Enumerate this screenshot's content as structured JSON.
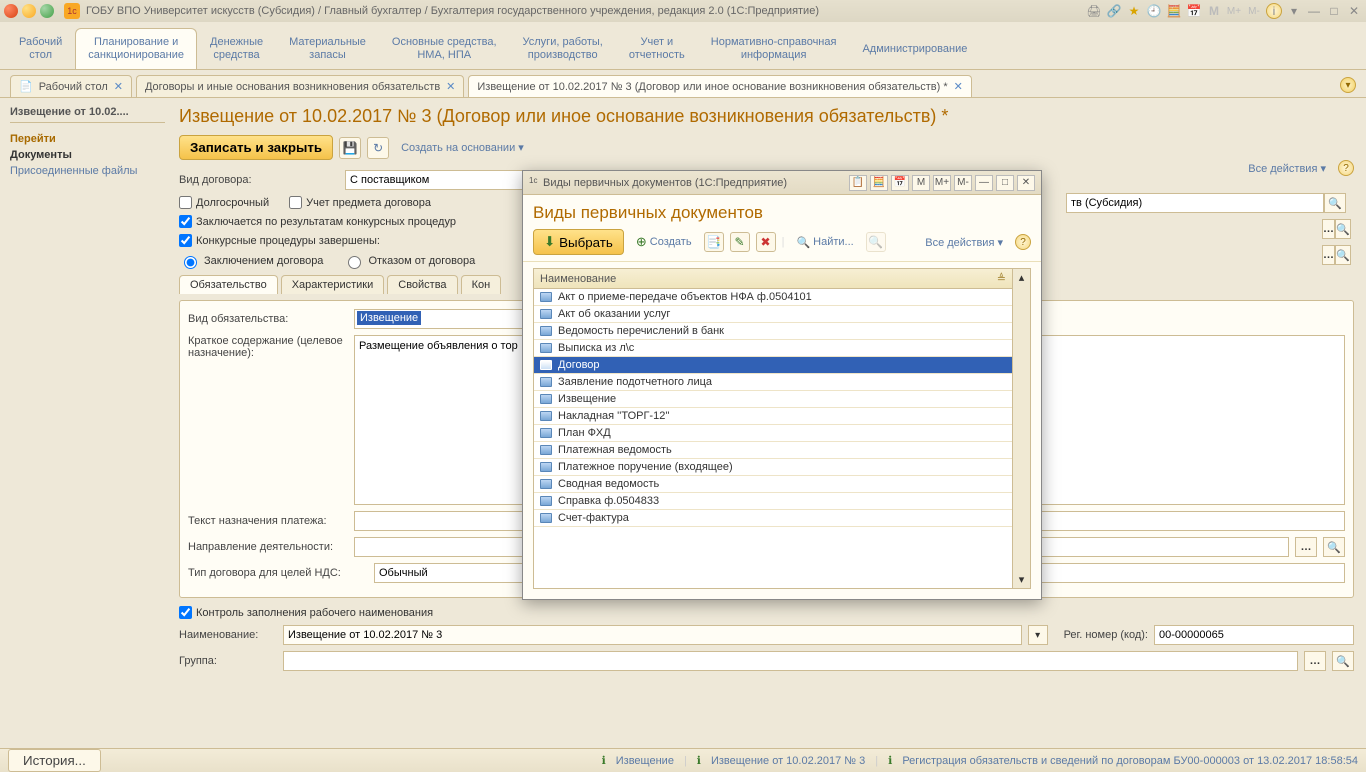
{
  "window": {
    "title": "ГОБУ ВПО Университет искусств (Субсидия) / Главный бухгалтер / Бухгалтерия государственного учреждения, редакция 2.0  (1С:Предприятие)",
    "logo": "1с"
  },
  "main_tabs": [
    {
      "line1": "Рабочий",
      "line2": "стол"
    },
    {
      "line1": "Планирование и",
      "line2": "санкционирование"
    },
    {
      "line1": "Денежные",
      "line2": "средства"
    },
    {
      "line1": "Материальные",
      "line2": "запасы"
    },
    {
      "line1": "Основные средства,",
      "line2": "НМА, НПА"
    },
    {
      "line1": "Услуги, работы,",
      "line2": "производство"
    },
    {
      "line1": "Учет и",
      "line2": "отчетность"
    },
    {
      "line1": "Нормативно-справочная",
      "line2": "информация"
    },
    {
      "line1": "Администрирование",
      "line2": ""
    }
  ],
  "doc_tabs": [
    {
      "label": "Рабочий стол",
      "closable": true,
      "icon": true
    },
    {
      "label": "Договоры и иные основания возникновения обязательств",
      "closable": true
    },
    {
      "label": "Извещение от 10.02.2017 № 3 (Договор или иное основание возникновения обязательств) *",
      "closable": true
    }
  ],
  "sidebar": {
    "header": "Извещение от 10.02....",
    "section1": "Перейти",
    "item1": "Документы",
    "item2": "Присоединенные файлы"
  },
  "page": {
    "title": "Извещение от 10.02.2017 № 3 (Договор или иное основание возникновения обязательств) *",
    "save_close": "Записать и закрыть",
    "create_based": "Создать на основании",
    "all_actions": "Все действия",
    "contract_type_label": "Вид договора:",
    "contract_type_value": "С поставщиком",
    "org_value": "тв (Субсидия)",
    "chk_long": "Долгосрочный",
    "chk_usage": "Учет предмета договора",
    "chk_comp": "Заключается по результатам конкурсных процедур",
    "chk_comp_done": "Конкурсные процедуры завершены:",
    "radio_sign": "Заключением договора",
    "radio_refuse": "Отказом от договора",
    "tabs2": [
      "Обязательство",
      "Характеристики",
      "Свойства",
      "Кон"
    ],
    "obl_label": "Вид обязательства:",
    "obl_value": "Извещение",
    "brief_label": "Краткое содержание (целевое назначение):",
    "brief_value": "Размещение объявления о тор",
    "pay_text_label": "Текст назначения платежа:",
    "dir_label": "Направление деятельности:",
    "nds_label": "Тип договора для целей НДС:",
    "nds_value": "Обычный",
    "chk_ctrl": "Контроль заполнения рабочего наименования",
    "name_label": "Наименование:",
    "name_value": "Извещение от 10.02.2017 № 3",
    "reg_label": "Рег. номер (код):",
    "reg_value": "00-00000065",
    "group_label": "Группа:"
  },
  "dialog": {
    "title": "Виды первичных документов  (1С:Предприятие)",
    "header": "Виды первичных документов",
    "btn_select": "Выбрать",
    "btn_create": "Создать",
    "btn_find": "Найти...",
    "all_actions": "Все действия",
    "col_name": "Наименование",
    "rows": [
      "Акт о приеме-передаче объектов НФА ф.0504101",
      "Акт об оказании услуг",
      "Ведомость перечислений в банк",
      "Выписка из л\\с",
      "Договор",
      "Заявление подотчетного лица",
      "Извещение",
      "Накладная ''ТОРГ-12''",
      "План ФХД",
      "Платежная ведомость",
      "Платежное поручение (входящее)",
      "Сводная ведомость",
      "Справка ф.0504833",
      "Счет-фактура"
    ],
    "selected_index": 4,
    "tb_m": "M",
    "tb_mp": "M+",
    "tb_mm": "M-"
  },
  "statusbar": {
    "history": "История...",
    "s1": "Извещение",
    "s2": "Извещение от 10.02.2017 № 3",
    "s3": "Регистрация обязательств и сведений по договорам БУ00-000003 от 13.02.2017 18:58:54"
  }
}
